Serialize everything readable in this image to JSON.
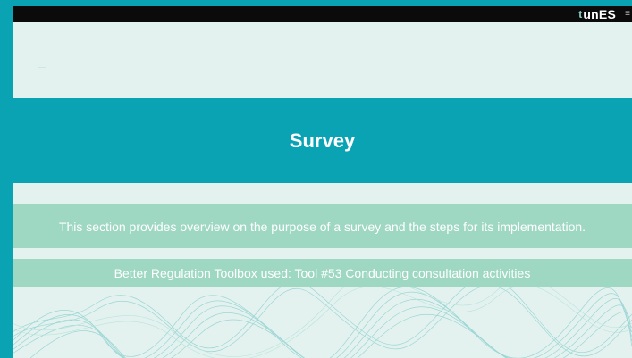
{
  "header": {
    "logo_mark": "t",
    "logo_text": "unES",
    "edge_glyph": "≡"
  },
  "title": "Survey",
  "overview_text": "This section provides overview on the purpose of a survey and the steps for its implementation.",
  "toolbox_text": "Better Regulation Toolbox used: Tool #53 Conducting consultation activities",
  "colors": {
    "frame": "#0aa3b4",
    "background": "#e3f2ef",
    "title_band": "#0aa3b4",
    "info_band": "#9ed7c2",
    "topbar": "#0b0b0b"
  },
  "decor": {
    "bottom_pattern": "teal-wave-lines"
  }
}
